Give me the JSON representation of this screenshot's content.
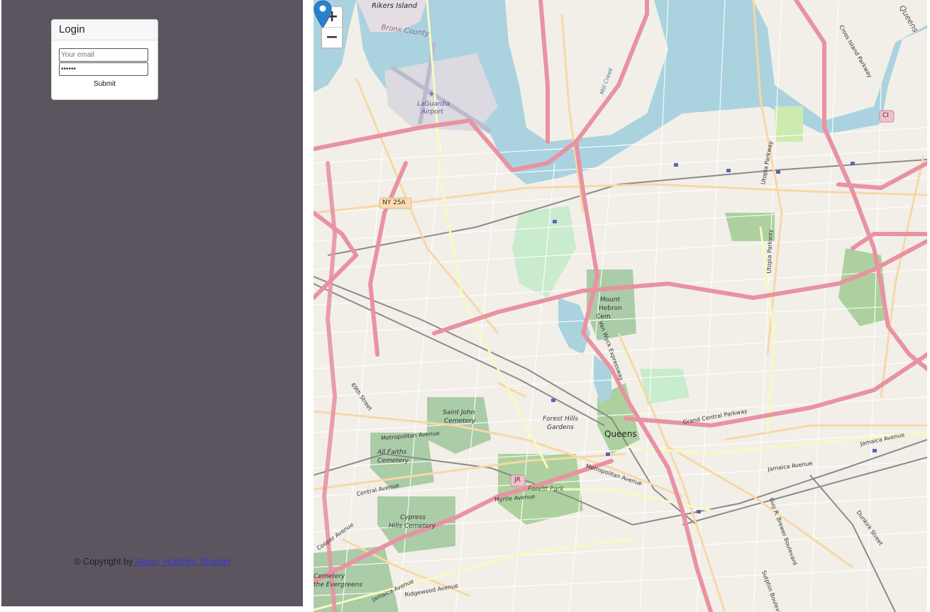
{
  "login": {
    "title": "Login",
    "email_placeholder": "Your email",
    "password_value": "••••••",
    "submit_label": "Submit"
  },
  "footer": {
    "prefix": "© Copyright by",
    "authors": " Aaron, Hoodley, Shantel"
  },
  "map": {
    "zoom_in_label": "+",
    "zoom_out_label": "−",
    "labels": {
      "rikers": "Rikers Island",
      "bronx": "Bronx County",
      "laguardia_1": "LaGuardia",
      "laguardia_2": "Airport",
      "ny25a": "NY 25A",
      "mount_hebron_1": "Mount",
      "mount_hebron_2": "Hebron",
      "mount_hebron_3": "Cem",
      "saint_john_1": "Saint John",
      "saint_john_2": "Cemetery",
      "forest_hills_1": "Forest Hills",
      "forest_hills_2": "Gardens",
      "queens": "Queens",
      "queens_county": "Queens",
      "all_faiths_1": "All Faiths",
      "all_faiths_2": "Cemetery",
      "forest_park": "Forest Park",
      "cypress_1": "Cypress",
      "cypress_2": "Hills Cemetery",
      "cemetery_evergreens_1": "Cemetery",
      "cemetery_evergreens_2": "the Evergreens",
      "grand_central": "Grand Central Parkway",
      "metropolitan": "Metropolitan Avenue",
      "metropolitan_2": "Metropolitan Avenue",
      "myrtle": "Myrtle Avenue",
      "central_ave": "Central Avenue",
      "jamaica_ave": "Jamaica Avenue",
      "jamaica_ave_2": "Jamaica Avenue",
      "jamaica_ave_3": "Jamaica Avenue",
      "ridgewood": "Ridgewood Avenue",
      "cooper": "Cooper Avenue",
      "utopia_1": "Utopia Parkway",
      "utopia_2": "Utopia Parkway",
      "cross_island": "Cross Island Parkway",
      "van_wyck": "Van Wyck Expressway",
      "guy_brewer": "Guy R. Brewer Boulevard",
      "dunkirk": "Dunkirk Street",
      "sutphin": "Sutphin Boulevard",
      "street_69": "69th Street",
      "mill_creek": "Mill Creek",
      "jr_shield": "JR",
      "ci_shield": "CI"
    }
  }
}
